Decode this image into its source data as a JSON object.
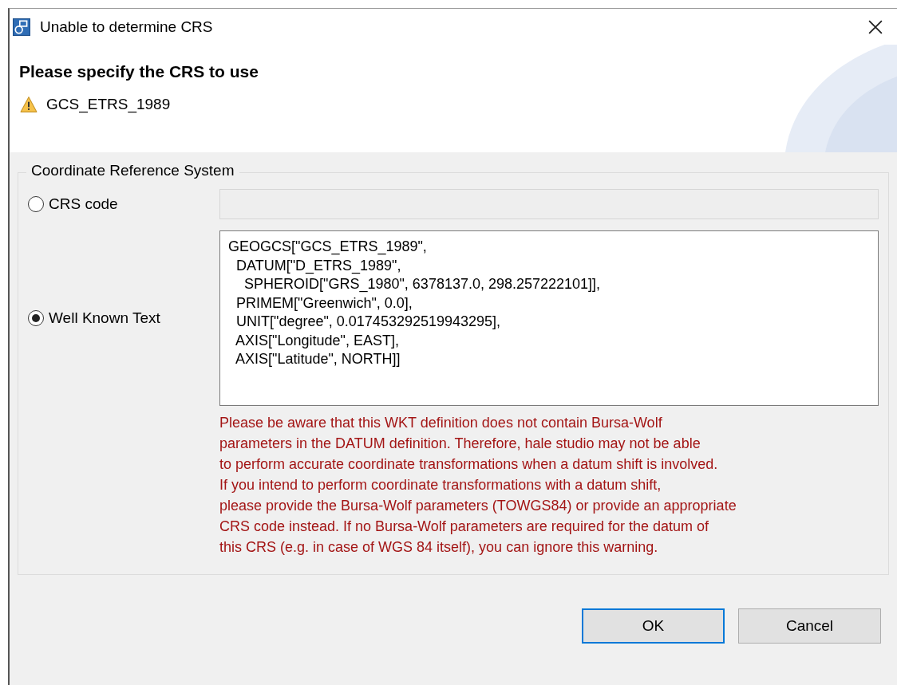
{
  "window": {
    "title": "Unable to determine CRS"
  },
  "header": {
    "title": "Please specify the CRS to use",
    "message": "GCS_ETRS_1989"
  },
  "group": {
    "title": "Coordinate Reference System",
    "options": [
      {
        "label": "CRS code",
        "selected": false,
        "kind": "code"
      },
      {
        "label": "Well Known Text",
        "selected": true,
        "kind": "wkt"
      }
    ],
    "wkt_lines": [
      "GEOGCS[\"GCS_ETRS_1989\",",
      "  DATUM[\"D_ETRS_1989\",",
      "    SPHEROID[\"GRS_1980\", 6378137.0, 298.257222101]],",
      "  PRIMEM[\"Greenwich\", 0.0],",
      "  UNIT[\"degree\", 0.017453292519943295],",
      "  AXIS[\"Longitude\", EAST],",
      "  AXIS[\"Latitude\", NORTH]]"
    ],
    "warning_lines": [
      "Please be aware that this WKT definition does not contain Bursa-Wolf",
      "parameters in the DATUM definition. Therefore, hale studio may not be able",
      "to perform accurate coordinate transformations when a datum shift is involved.",
      "If you intend to perform coordinate transformations with a datum shift,",
      "please provide the Bursa-Wolf parameters (TOWGS84) or provide an appropriate",
      "CRS code instead. If no Bursa-Wolf parameters are required for the datum of",
      "this CRS (e.g. in case of WGS 84 itself), you can ignore this warning."
    ]
  },
  "buttons": [
    {
      "label": "OK",
      "default": true
    },
    {
      "label": "Cancel",
      "default": false
    }
  ]
}
